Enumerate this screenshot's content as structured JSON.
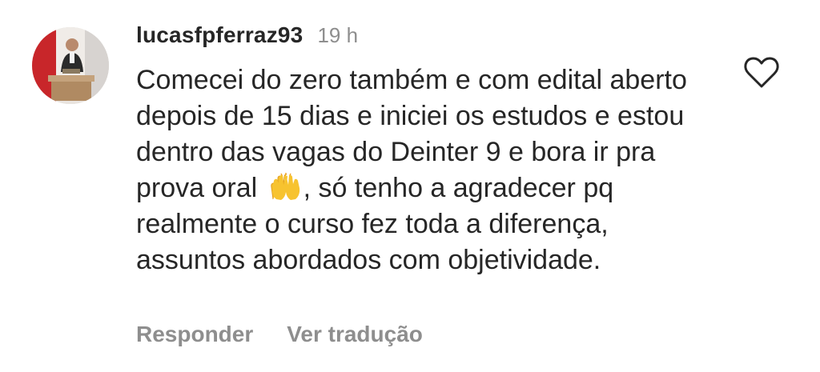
{
  "comment": {
    "username": "lucasfpferraz93",
    "time": "19 h",
    "text_before_emoji": "Comecei do zero também e com edital aberto depois de 15 dias e iniciei os estudos e estou dentro das vagas do Deinter 9 e bora ir pra prova oral ",
    "emoji": "🙌",
    "text_after_emoji": ", só tenho a agradecer pq realmente o curso fez toda a diferença, assuntos abordados com objetividade."
  },
  "actions": {
    "reply_label": "Responder",
    "translate_label": "Ver tradução"
  },
  "icons": {
    "like": "heart-outline-icon",
    "avatar": "user-avatar"
  },
  "colors": {
    "text": "#262626",
    "secondary": "#8e8e8e",
    "background": "#ffffff"
  }
}
